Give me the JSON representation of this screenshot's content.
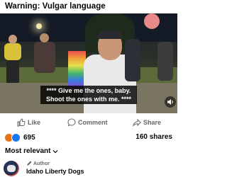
{
  "post": {
    "warning": "Warning: Vulgar language"
  },
  "video": {
    "caption_line1": "**** Give me the ones, baby.",
    "caption_line2": "Shoot the ones with me. ****",
    "volume_icon": "speaker-icon"
  },
  "actions": {
    "like": "Like",
    "comment": "Comment",
    "share": "Share"
  },
  "stats": {
    "reaction_count": "695",
    "shares": "160 shares"
  },
  "comments": {
    "sort_label": "Most relevant",
    "first": {
      "badge": "Author",
      "name": "Idaho Liberty Dogs"
    }
  },
  "colors": {
    "accent": "#1877f2",
    "angry": "#e9710f",
    "like": "#1877f2"
  }
}
